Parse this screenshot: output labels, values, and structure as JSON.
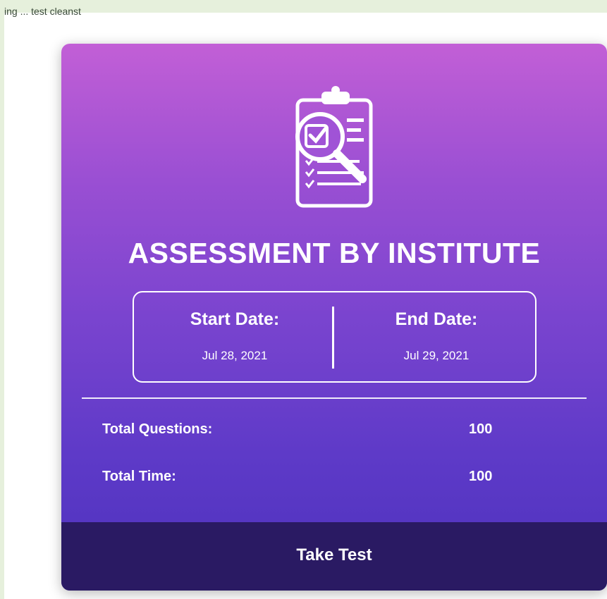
{
  "page": {
    "top_fragment": "ing ... test cleanst"
  },
  "card": {
    "title": "ASSESSMENT BY INSTITUTE",
    "icon": "clipboard-magnifier-icon",
    "start_label": "Start Date:",
    "start_value": "Jul 28, 2021",
    "end_label": "End Date:",
    "end_value": "Jul 29, 2021",
    "total_questions_label": "Total Questions:",
    "total_questions_value": "100",
    "total_time_label": "Total Time:",
    "total_time_value": "100",
    "button_label": "Take Test"
  },
  "colors": {
    "gradient_top": "#c25fd6",
    "gradient_bottom": "#4d32bd",
    "button_bg": "#2a1a63",
    "page_bg": "#e6f0dc"
  }
}
